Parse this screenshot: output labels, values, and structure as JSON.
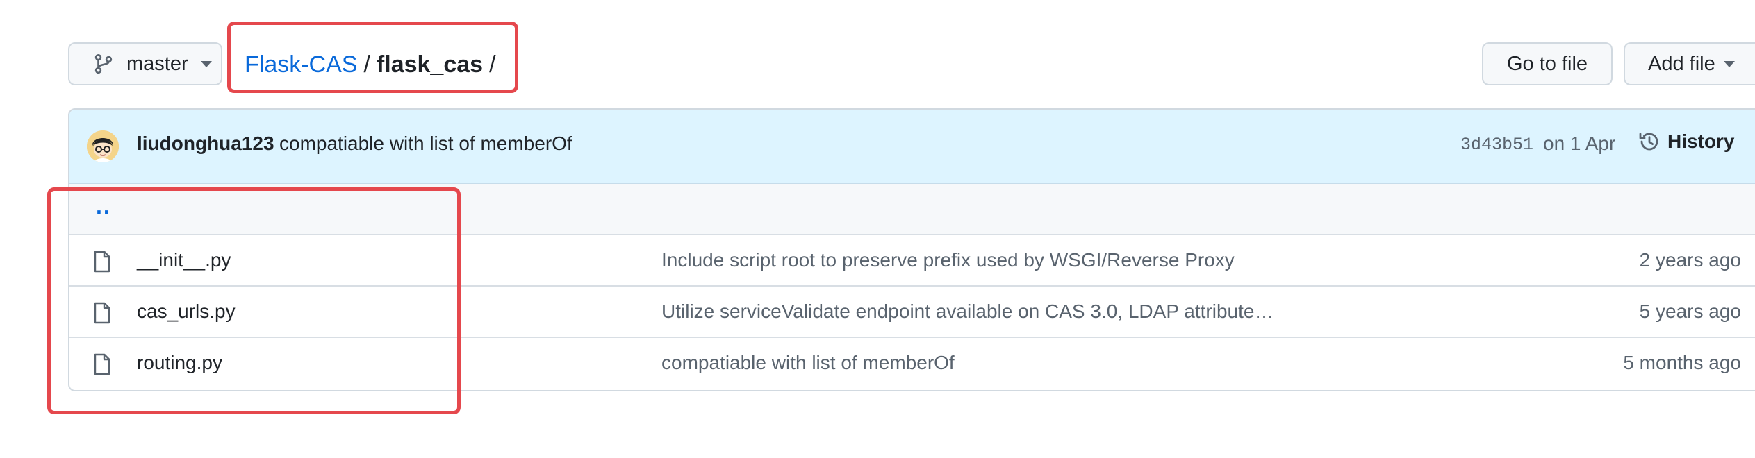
{
  "branch": {
    "name": "master",
    "icon": "git-branch-icon"
  },
  "breadcrumb": {
    "repo": "Flask-CAS",
    "separator": "/",
    "directory": "flask_cas",
    "trailing_separator": "/"
  },
  "actions": {
    "go_to_file": "Go to file",
    "add_file": "Add file"
  },
  "latest_commit": {
    "author": "liudonghua123",
    "message": "compatiable with list of memberOf",
    "sha": "3d43b51",
    "date": "on 1 Apr",
    "history_label": "History"
  },
  "parent_dir": {
    "label": ".."
  },
  "files": [
    {
      "name": "__init__.py",
      "commit_message": "Include script root to preserve prefix used by WSGI/Reverse Proxy",
      "age": "2 years ago"
    },
    {
      "name": "cas_urls.py",
      "commit_message": "Utilize serviceValidate endpoint available on CAS 3.0, LDAP attribute…",
      "age": "5 years ago"
    },
    {
      "name": "routing.py",
      "commit_message": "compatiable with list of memberOf",
      "age": "5 months ago"
    }
  ],
  "colors": {
    "link": "#0969da",
    "annotation": "#e5484d",
    "header_bg": "#ddf4ff",
    "muted": "#59636e"
  }
}
